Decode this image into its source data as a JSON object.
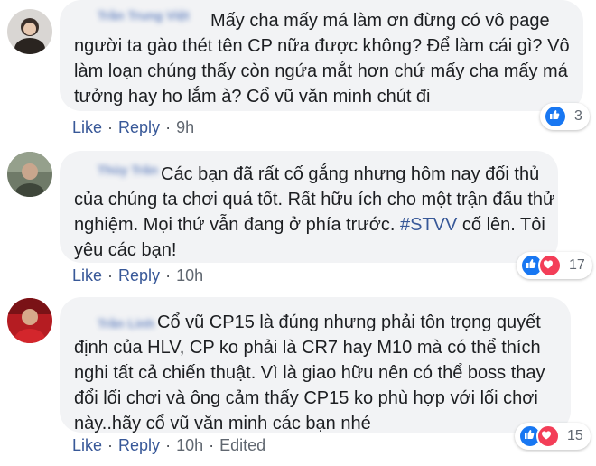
{
  "comments": [
    {
      "author": "Trần Trung Việt",
      "lines": [
        "Mấy cha mấy má làm ơn đừng có vô page",
        "người ta gào thét tên CP nữa được không? Để làm cái gì? Vô",
        "làm loạn chúng thấy còn ngứa mắt hơn chứ mấy cha mấy má",
        "tưởng hay ho lắm à? Cổ vũ văn minh chút đi"
      ],
      "like": "Like",
      "reply": "Reply",
      "time": "9h",
      "reaction_count": "3",
      "reactions": [
        "like-icon"
      ]
    },
    {
      "author": "Thùy Trân",
      "lines": [
        "Các bạn đã rất cố gắng nhưng hôm nay đối thủ",
        "của chúng ta chơi quá tốt. Rất hữu ích cho một trận đấu thử",
        "nghiệm. Mọi thứ vẫn đang ở phía trước. ",
        "yêu các bạn!"
      ],
      "hashtag": "#STVV",
      "after_hashtag": " cố lên. Tôi",
      "like": "Like",
      "reply": "Reply",
      "time": "10h",
      "reaction_count": "17",
      "reactions": [
        "like-icon",
        "love-icon"
      ]
    },
    {
      "author": "Trần Linh",
      "lines": [
        "Cổ vũ CP15 là đúng nhưng phải tôn trọng quyết",
        "định của HLV, CP ko phải là CR7 hay M10 mà có thể thích",
        "nghi tất cả chiến thuật. Vì là giao hữu nên có thể boss thay",
        "đổi lối chơi và ông cảm thấy CP15 ko phù hợp với lối chơi",
        "này..hãy cổ vũ văn minh các bạn nhé"
      ],
      "like": "Like",
      "reply": "Reply",
      "time": "10h",
      "edited": "Edited",
      "reaction_count": "15",
      "reactions": [
        "like-icon",
        "love-icon"
      ]
    }
  ],
  "colors": {
    "link": "#385898",
    "bubble": "#f2f3f5",
    "like_blue": "#1877f2",
    "love_red": "#f33e58"
  }
}
